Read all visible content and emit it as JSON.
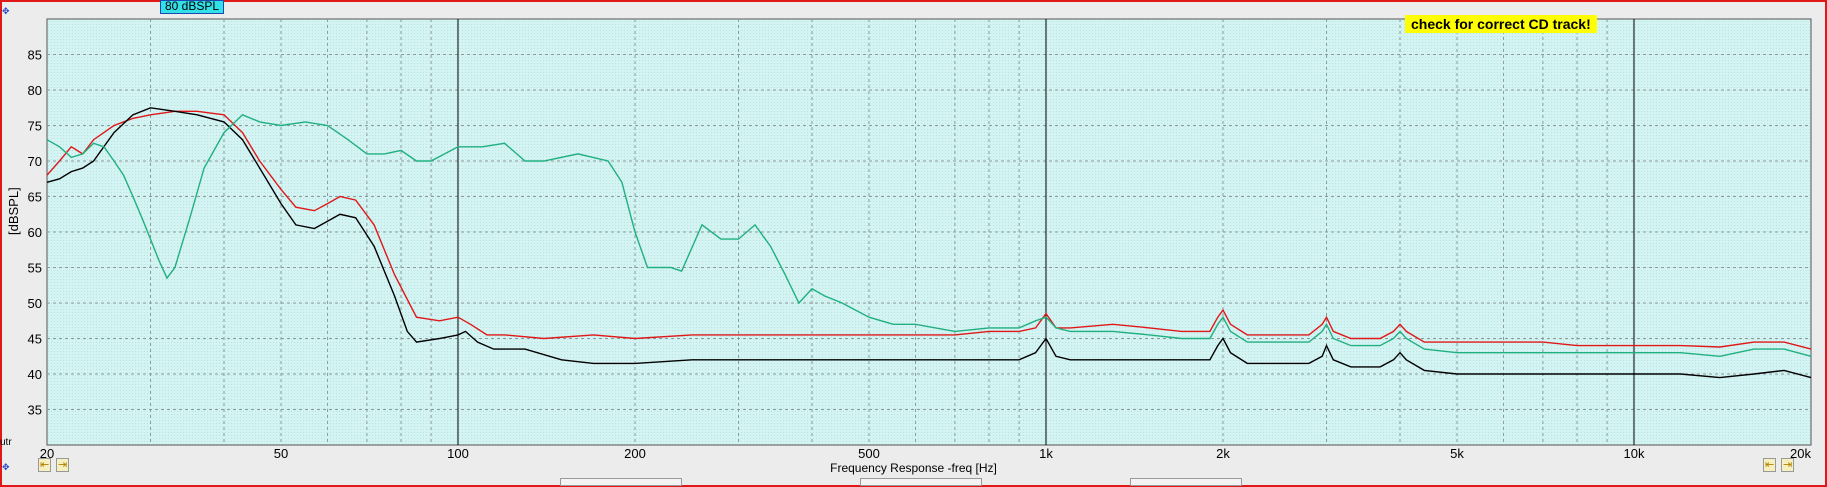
{
  "header": {
    "level_badge": "80 dBSPL",
    "notice": "check for correct CD track!"
  },
  "corner_label": "utr",
  "chart_data": {
    "type": "line",
    "title": "",
    "xlabel": "Frequency Response -freq [Hz]",
    "ylabel": "[dBSPL]",
    "xscale": "log",
    "xlim": [
      20,
      20000
    ],
    "ylim": [
      30,
      90
    ],
    "grid": true,
    "background": "#d2f2f2",
    "yticks": [
      35,
      40,
      45,
      50,
      55,
      60,
      65,
      70,
      75,
      80,
      85
    ],
    "xticks": [
      {
        "value": 20,
        "label": "20"
      },
      {
        "value": 50,
        "label": "50"
      },
      {
        "value": 100,
        "label": "100"
      },
      {
        "value": 200,
        "label": "200"
      },
      {
        "value": 500,
        "label": "500"
      },
      {
        "value": 1000,
        "label": "1k"
      },
      {
        "value": 2000,
        "label": "2k"
      },
      {
        "value": 5000,
        "label": "5k"
      },
      {
        "value": 10000,
        "label": "10k"
      },
      {
        "value": 20000,
        "label": "20k"
      }
    ],
    "decade_lines": [
      100,
      1000,
      10000
    ],
    "series": [
      {
        "color": "#e01818",
        "points": [
          [
            20,
            68
          ],
          [
            21,
            70
          ],
          [
            22,
            72
          ],
          [
            23,
            71
          ],
          [
            24,
            73
          ],
          [
            26,
            75
          ],
          [
            28,
            76
          ],
          [
            30,
            76.5
          ],
          [
            33,
            77
          ],
          [
            36,
            77
          ],
          [
            40,
            76.5
          ],
          [
            43,
            74
          ],
          [
            46,
            70
          ],
          [
            50,
            66
          ],
          [
            53,
            63.5
          ],
          [
            57,
            63
          ],
          [
            60,
            64
          ],
          [
            63,
            65
          ],
          [
            67,
            64.5
          ],
          [
            72,
            61
          ],
          [
            78,
            54
          ],
          [
            85,
            48
          ],
          [
            93,
            47.5
          ],
          [
            100,
            48
          ],
          [
            105,
            47
          ],
          [
            112,
            45.5
          ],
          [
            120,
            45.5
          ],
          [
            140,
            45
          ],
          [
            170,
            45.5
          ],
          [
            200,
            45
          ],
          [
            250,
            45.5
          ],
          [
            300,
            45.5
          ],
          [
            400,
            45.5
          ],
          [
            500,
            45.5
          ],
          [
            600,
            45.5
          ],
          [
            700,
            45.5
          ],
          [
            800,
            46
          ],
          [
            900,
            46
          ],
          [
            960,
            46.5
          ],
          [
            1000,
            48.5
          ],
          [
            1040,
            46.5
          ],
          [
            1100,
            46.5
          ],
          [
            1300,
            47
          ],
          [
            1500,
            46.5
          ],
          [
            1700,
            46
          ],
          [
            1900,
            46
          ],
          [
            1960,
            48
          ],
          [
            2000,
            49
          ],
          [
            2060,
            47
          ],
          [
            2200,
            45.5
          ],
          [
            2500,
            45.5
          ],
          [
            2800,
            45.5
          ],
          [
            2950,
            47
          ],
          [
            3000,
            48
          ],
          [
            3080,
            46
          ],
          [
            3300,
            45
          ],
          [
            3700,
            45
          ],
          [
            3900,
            46
          ],
          [
            4000,
            47
          ],
          [
            4100,
            46
          ],
          [
            4400,
            44.5
          ],
          [
            5000,
            44.5
          ],
          [
            6000,
            44.5
          ],
          [
            7000,
            44.5
          ],
          [
            8000,
            44
          ],
          [
            10000,
            44
          ],
          [
            12000,
            44
          ],
          [
            14000,
            43.8
          ],
          [
            16000,
            44.5
          ],
          [
            18000,
            44.5
          ],
          [
            20000,
            43.5
          ]
        ]
      },
      {
        "color": "#000000",
        "points": [
          [
            20,
            67
          ],
          [
            21,
            67.5
          ],
          [
            22,
            68.5
          ],
          [
            23,
            69
          ],
          [
            24,
            70
          ],
          [
            26,
            74
          ],
          [
            28,
            76.5
          ],
          [
            30,
            77.5
          ],
          [
            33,
            77
          ],
          [
            36,
            76.5
          ],
          [
            40,
            75.5
          ],
          [
            43,
            73
          ],
          [
            46,
            69
          ],
          [
            50,
            64
          ],
          [
            53,
            61
          ],
          [
            57,
            60.5
          ],
          [
            60,
            61.5
          ],
          [
            63,
            62.5
          ],
          [
            67,
            62
          ],
          [
            72,
            58
          ],
          [
            78,
            51
          ],
          [
            82,
            46
          ],
          [
            85,
            44.5
          ],
          [
            93,
            45
          ],
          [
            100,
            45.5
          ],
          [
            103,
            46
          ],
          [
            108,
            44.5
          ],
          [
            115,
            43.5
          ],
          [
            130,
            43.5
          ],
          [
            150,
            42
          ],
          [
            170,
            41.5
          ],
          [
            200,
            41.5
          ],
          [
            250,
            42
          ],
          [
            300,
            42
          ],
          [
            400,
            42
          ],
          [
            500,
            42
          ],
          [
            600,
            42
          ],
          [
            700,
            42
          ],
          [
            800,
            42
          ],
          [
            900,
            42
          ],
          [
            960,
            43
          ],
          [
            1000,
            45
          ],
          [
            1040,
            42.5
          ],
          [
            1100,
            42
          ],
          [
            1300,
            42
          ],
          [
            1500,
            42
          ],
          [
            1700,
            42
          ],
          [
            1900,
            42
          ],
          [
            1960,
            44
          ],
          [
            2000,
            45
          ],
          [
            2060,
            43
          ],
          [
            2200,
            41.5
          ],
          [
            2500,
            41.5
          ],
          [
            2800,
            41.5
          ],
          [
            2950,
            42.5
          ],
          [
            3000,
            44
          ],
          [
            3080,
            42
          ],
          [
            3300,
            41
          ],
          [
            3700,
            41
          ],
          [
            3900,
            42
          ],
          [
            4000,
            43
          ],
          [
            4100,
            42
          ],
          [
            4400,
            40.5
          ],
          [
            5000,
            40
          ],
          [
            6000,
            40
          ],
          [
            7000,
            40
          ],
          [
            8000,
            40
          ],
          [
            10000,
            40
          ],
          [
            12000,
            40
          ],
          [
            14000,
            39.5
          ],
          [
            16000,
            40
          ],
          [
            18000,
            40.5
          ],
          [
            20000,
            39.5
          ]
        ]
      },
      {
        "color": "#20b080",
        "points": [
          [
            20,
            73
          ],
          [
            21,
            72
          ],
          [
            22,
            70.5
          ],
          [
            23,
            71
          ],
          [
            24,
            72.5
          ],
          [
            25,
            72
          ],
          [
            26,
            70
          ],
          [
            27,
            68
          ],
          [
            28,
            65
          ],
          [
            29,
            62
          ],
          [
            30,
            59
          ],
          [
            31,
            56
          ],
          [
            32,
            53.5
          ],
          [
            33,
            55
          ],
          [
            35,
            62
          ],
          [
            37,
            69
          ],
          [
            40,
            74
          ],
          [
            43,
            76.5
          ],
          [
            46,
            75.5
          ],
          [
            50,
            75
          ],
          [
            55,
            75.5
          ],
          [
            60,
            75
          ],
          [
            65,
            73
          ],
          [
            70,
            71
          ],
          [
            75,
            71
          ],
          [
            80,
            71.5
          ],
          [
            85,
            70
          ],
          [
            90,
            70
          ],
          [
            100,
            72
          ],
          [
            110,
            72
          ],
          [
            120,
            72.5
          ],
          [
            130,
            70
          ],
          [
            140,
            70
          ],
          [
            160,
            71
          ],
          [
            180,
            70
          ],
          [
            190,
            67
          ],
          [
            200,
            60
          ],
          [
            210,
            55
          ],
          [
            230,
            55
          ],
          [
            240,
            54.5
          ],
          [
            260,
            61
          ],
          [
            280,
            59
          ],
          [
            300,
            59
          ],
          [
            320,
            61
          ],
          [
            340,
            58
          ],
          [
            360,
            54
          ],
          [
            380,
            50
          ],
          [
            400,
            52
          ],
          [
            420,
            51
          ],
          [
            450,
            50
          ],
          [
            500,
            48
          ],
          [
            550,
            47
          ],
          [
            600,
            47
          ],
          [
            700,
            46
          ],
          [
            800,
            46.5
          ],
          [
            900,
            46.5
          ],
          [
            960,
            47.5
          ],
          [
            1000,
            48
          ],
          [
            1040,
            46.5
          ],
          [
            1100,
            46
          ],
          [
            1300,
            46
          ],
          [
            1500,
            45.5
          ],
          [
            1700,
            45
          ],
          [
            1900,
            45
          ],
          [
            1960,
            47
          ],
          [
            2000,
            48
          ],
          [
            2060,
            46
          ],
          [
            2200,
            44.5
          ],
          [
            2500,
            44.5
          ],
          [
            2800,
            44.5
          ],
          [
            2950,
            46
          ],
          [
            3000,
            47
          ],
          [
            3080,
            45
          ],
          [
            3300,
            44
          ],
          [
            3700,
            44
          ],
          [
            3900,
            45
          ],
          [
            4000,
            46
          ],
          [
            4100,
            45
          ],
          [
            4400,
            43.5
          ],
          [
            5000,
            43
          ],
          [
            6000,
            43
          ],
          [
            7000,
            43
          ],
          [
            8000,
            43
          ],
          [
            10000,
            43
          ],
          [
            12000,
            43
          ],
          [
            14000,
            42.5
          ],
          [
            16000,
            43.5
          ],
          [
            18000,
            43.5
          ],
          [
            20000,
            42.5
          ]
        ]
      }
    ]
  }
}
